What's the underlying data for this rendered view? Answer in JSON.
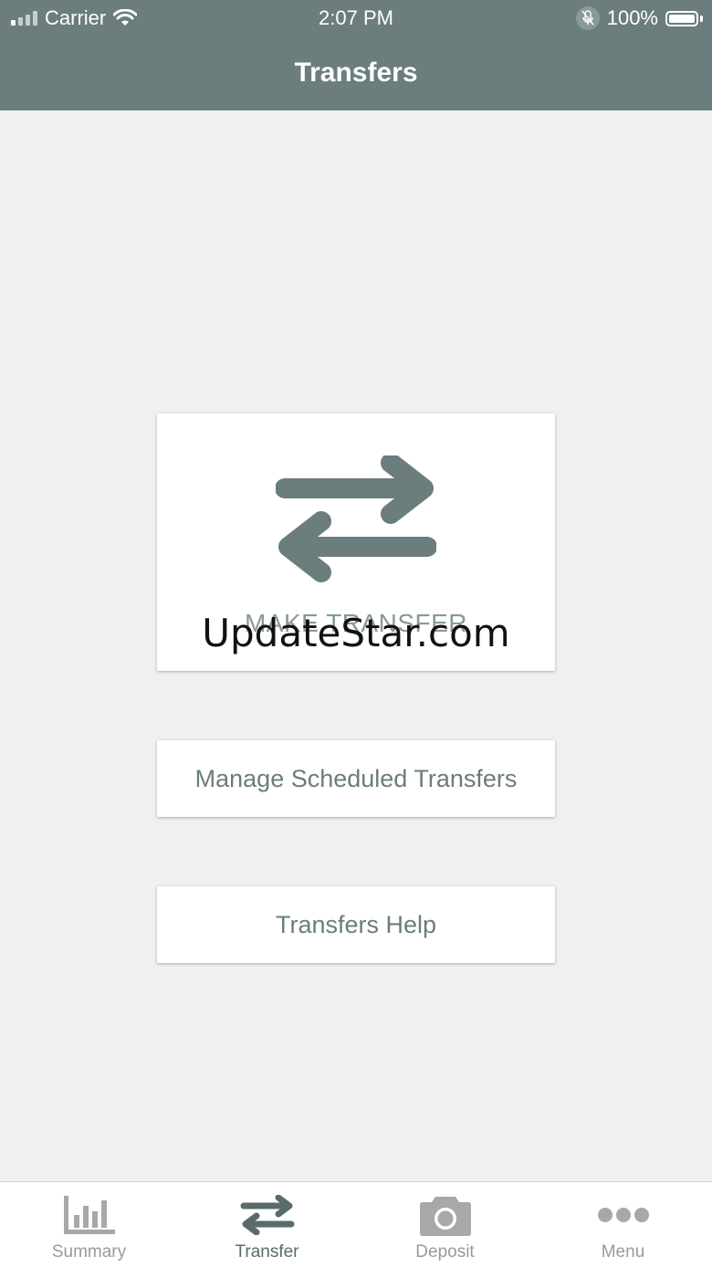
{
  "status_bar": {
    "carrier": "Carrier",
    "time": "2:07 PM",
    "battery": "100%"
  },
  "header": {
    "title": "Transfers"
  },
  "cards": {
    "make_transfer_label": "MAKE TRANSFER",
    "watermark": "UpdateStar.com",
    "manage_scheduled_label": "Manage Scheduled Transfers",
    "help_label": "Transfers Help"
  },
  "tabs": [
    {
      "label": "Summary",
      "icon": "bar-chart-icon",
      "active": false
    },
    {
      "label": "Transfer",
      "icon": "transfer-arrows-icon",
      "active": true
    },
    {
      "label": "Deposit",
      "icon": "camera-icon",
      "active": false
    },
    {
      "label": "Menu",
      "icon": "more-dots-icon",
      "active": false
    }
  ],
  "colors": {
    "header_bg": "#6b7d7d",
    "accent": "#6b7d7d",
    "page_bg": "#f0f0f0",
    "inactive_tab": "#a8a8a8"
  }
}
